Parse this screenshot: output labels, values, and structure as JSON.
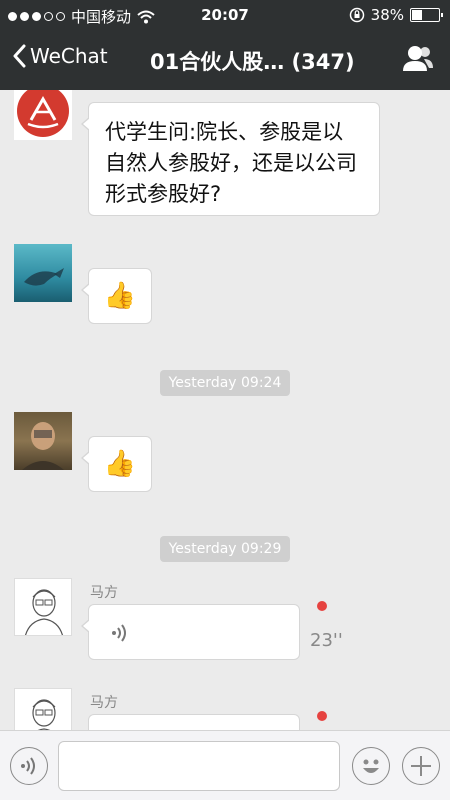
{
  "status_bar": {
    "carrier": "中国移动",
    "time": "20:07",
    "battery_percent": "38%",
    "battery_level": 0.38,
    "signal_filled": 3,
    "signal_total": 5
  },
  "nav": {
    "back_label": "WeChat",
    "title": "01合伙人股… (347)"
  },
  "messages": [
    {
      "type": "text",
      "sender": "",
      "text": "代学生问:院长、参股是以自然人参股好，还是以公司形式参股好?"
    },
    {
      "type": "emoji",
      "sender": "",
      "emoji": "👍"
    },
    {
      "type": "timestamp",
      "text": "Yesterday 09:24"
    },
    {
      "type": "emoji",
      "sender": "",
      "emoji": "👍"
    },
    {
      "type": "timestamp",
      "text": "Yesterday 09:29"
    },
    {
      "type": "voice",
      "sender": "马方",
      "duration": "23''",
      "unread": true
    },
    {
      "type": "voice",
      "sender": "马方",
      "duration": "",
      "unread": true
    }
  ],
  "colors": {
    "header_bg": "#2e3132",
    "chat_bg": "#ebebeb",
    "unread_dot": "#e64340",
    "timestamp_bg": "#cfcfcf"
  },
  "icons": {
    "back": "chevron-left-icon",
    "group": "contacts-icon",
    "voice": "voice-wave-icon",
    "emoji": "emoji-smile-icon",
    "plus": "plus-icon"
  }
}
